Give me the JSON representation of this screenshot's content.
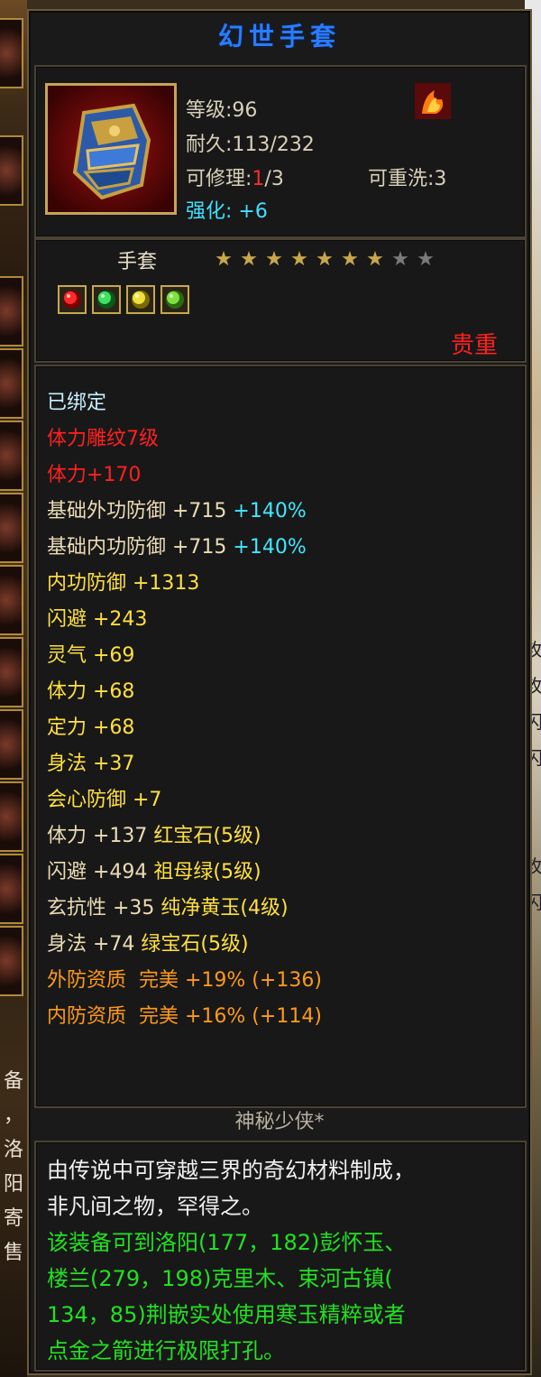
{
  "item": {
    "name": "幻世手套",
    "level_label": "等级:96",
    "durability_label": "耐久:113/232",
    "repair_prefix": "可修理:",
    "repair_used": "1",
    "repair_suffix": "/3",
    "rewash_label": "可重洗:3",
    "strengthen_label": "强化: +6",
    "type": "手套",
    "stars_filled": 7,
    "stars_total": 9,
    "rarity": "贵重",
    "gems": [
      "ruby-gem-icon",
      "emerald-gem-icon",
      "yellow-jade-gem-icon",
      "green-gem-icon"
    ]
  },
  "attributes": [
    {
      "text": "已绑定",
      "color": "cyan"
    },
    {
      "text": "体力雕纹7级",
      "color": "red"
    },
    {
      "text": "体力+170",
      "color": "red"
    },
    {
      "text": "基础外功防御 +715",
      "extra": " +140%",
      "color": "tan"
    },
    {
      "text": "基础内功防御 +715",
      "extra": " +140%",
      "color": "tan"
    },
    {
      "text": "内功防御 +1313",
      "color": "yellow"
    },
    {
      "text": "闪避 +243",
      "color": "yellow"
    },
    {
      "text": "灵气 +69",
      "color": "yellow"
    },
    {
      "text": "体力 +68",
      "color": "yellow"
    },
    {
      "text": "定力 +68",
      "color": "yellow"
    },
    {
      "text": "身法 +37",
      "color": "yellow"
    },
    {
      "text": "会心防御 +7",
      "color": "yellow"
    },
    {
      "text": "体力 +137",
      "extra": " 红宝石(5级)",
      "color": "tan",
      "extra_color": "yellow"
    },
    {
      "text": "闪避 +494",
      "extra": " 祖母绿(5级)",
      "color": "tan",
      "extra_color": "yellow"
    },
    {
      "text": "玄抗性 +35",
      "extra": " 纯净黄玉(4级)",
      "color": "tan",
      "extra_color": "yellow"
    },
    {
      "text": "身法 +74",
      "extra": " 绿宝石(5级)",
      "color": "tan",
      "extra_color": "yellow"
    },
    {
      "text": "外防资质  完美 +19% (+136)",
      "color": "orange"
    },
    {
      "text": "内防资质  完美 +16% (+114)",
      "color": "orange"
    }
  ],
  "owner": "神秘少侠*",
  "description": {
    "lore": [
      "由传说中可穿越三界的奇幻材料制成，",
      "非凡间之物，罕得之。"
    ],
    "hint": [
      "该装备可到洛阳(177，182)彭怀玉、",
      "楼兰(279，198)克里木、束河古镇(",
      "134，85)荆嵌实处使用寒玉精粹或者",
      "点金之箭进行极限打孔。"
    ]
  },
  "background": {
    "left_chars": [
      "备",
      "，",
      "洛",
      "阳",
      "寄",
      "售"
    ],
    "right_chars": [
      "攻",
      "攻",
      "闪",
      "闪",
      "：",
      "：",
      "攻",
      "闪"
    ]
  },
  "colors": {
    "title": "#2a7cff",
    "rarity": "#ff2020",
    "cyan": "#c8f0ff",
    "red": "#ff2020",
    "tan": "#ecdcb4",
    "yellow": "#ffe040",
    "percent": "#40e8ff",
    "orange": "#ff9a18",
    "green": "#22e022"
  }
}
